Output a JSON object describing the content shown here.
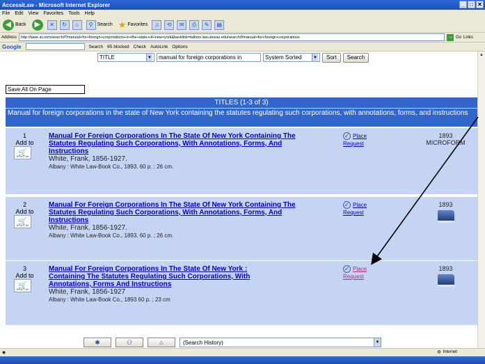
{
  "window": {
    "title": "Accessit.aw - Microsoft Internet Explorer"
  },
  "menu": [
    "File",
    "Edit",
    "View",
    "Favorites",
    "Tools",
    "Help"
  ],
  "toolbar": {
    "back": "Back",
    "search": "Search",
    "favorites": "Favorites"
  },
  "address": {
    "label": "Address",
    "url": "http://lawe.ai.com/search/f?manual+for+foreign+corporations+in+the+state+of+new+york&backlink=tallons.law.utexas.edu/search/f/manual+for+foreign+corporations",
    "go": "Go",
    "links": "Links"
  },
  "googlebar": {
    "logo": "Google",
    "search": "Search",
    "blocked": "65 blocked",
    "check": "Check",
    "autolink": "AutoLink",
    "options": "Options"
  },
  "search": {
    "field": "TITLE",
    "query": "manual for foreign corporations in",
    "sort": "System Sorted",
    "sort_btn": "Sort",
    "search_btn": "Search"
  },
  "save_all": "Save All On Page",
  "titles_header": "TITLES (1-3 of 3)",
  "subject": "Manual for foreign corporations in the state of New York containing the statutes regulating such corporations, with annotations, forms, and instructions",
  "records": [
    {
      "num": "1",
      "add": "Add to",
      "cart": "Book Cart",
      "title": "Manual For Foreign Corporations In The State Of New York Containing The Statutes Regulating Such Corporations, With Annotations, Forms, And Instructions",
      "author": "White, Frank, 1856-1927.",
      "pub": "Albany : White Law-Book Co., 1893.   60 p. ; 26 cm.",
      "place": "Place",
      "request": "Request",
      "year": "1893",
      "format": "MICROFORM"
    },
    {
      "num": "2",
      "add": "Add to",
      "cart": "Book Cart",
      "title": "Manual For Foreign Corporations In The State Of New York Containing The Statutes Regulating Such Corporations, With Annotations, Forms, And Instructions",
      "author": "White, Frank, 1856-1927.",
      "pub": "Albany : White Law-Book Co., 1893.   60 p. ; 26 cm.",
      "place": "Place",
      "request": "Request",
      "year": "1893"
    },
    {
      "num": "3",
      "add": "Add to",
      "cart": "Book Cart",
      "title": "Manual For Foreign Corporations In The State Of New York : Containing The Statutes Regulating Such Corporations, With Annotations, Forms And Instructions",
      "author": "White, Frank, 1856-1927",
      "pub": "Albany : White Law-Book Co., 1893   60 p. ; 23 cm",
      "place": "Place",
      "request": "Request",
      "year": "1893"
    }
  ],
  "bottom": {
    "history": "(Search History)"
  },
  "status": {
    "zone": "Internet"
  }
}
